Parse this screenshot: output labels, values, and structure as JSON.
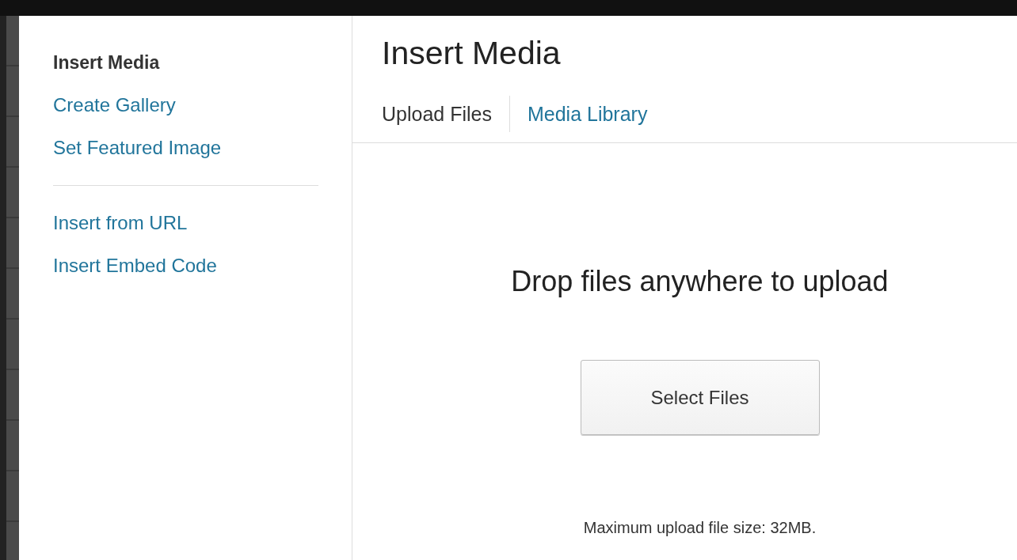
{
  "sidebar": {
    "items": [
      {
        "label": "Insert Media",
        "selected": true
      },
      {
        "label": "Create Gallery",
        "selected": false
      },
      {
        "label": "Set Featured Image",
        "selected": false
      }
    ],
    "extra_items": [
      {
        "label": "Insert from URL",
        "selected": false
      },
      {
        "label": "Insert Embed Code",
        "selected": false
      }
    ]
  },
  "title": "Insert Media",
  "tabs": [
    {
      "label": "Upload Files",
      "selected": true
    },
    {
      "label": "Media Library",
      "selected": false
    }
  ],
  "upload": {
    "message": "Drop files anywhere to upload",
    "button": "Select Files",
    "note": "Maximum upload file size: 32MB."
  }
}
